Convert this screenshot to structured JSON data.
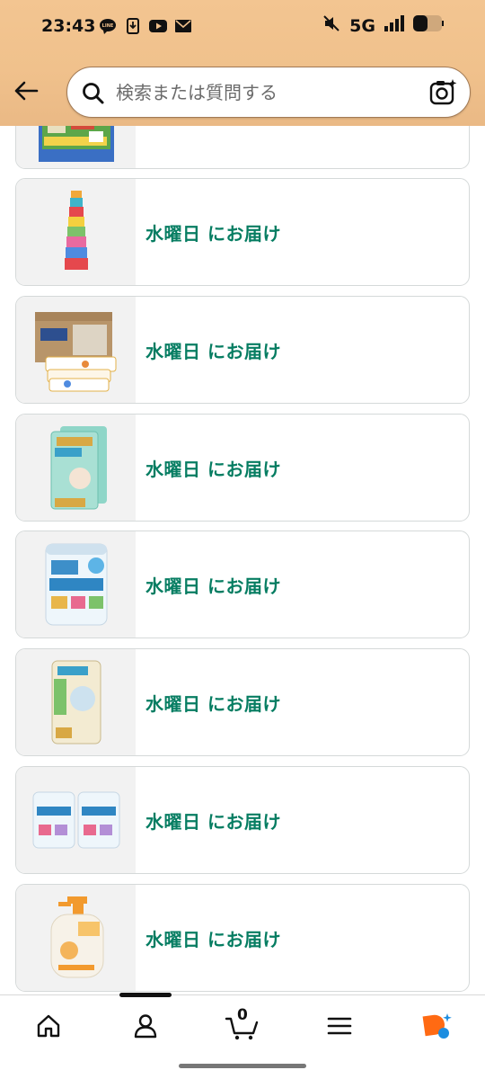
{
  "status_bar": {
    "time": "23:43",
    "network": "5G",
    "left_icons": [
      "line-icon",
      "download-icon",
      "youtube-icon",
      "mail-icon"
    ],
    "right_icons": [
      "mute-icon",
      "signal-icon",
      "battery-icon"
    ]
  },
  "search": {
    "placeholder": "検索または質問する"
  },
  "orders": [
    {
      "delivery": "",
      "image": "toy-playmat-box"
    },
    {
      "delivery": "水曜日 にお届け",
      "image": "stacking-cups-toy"
    },
    {
      "delivery": "水曜日 にお届け",
      "image": "goon-diapers-case"
    },
    {
      "delivery": "水曜日 にお届け",
      "image": "pampers-186-pack"
    },
    {
      "delivery": "水曜日 にお届け",
      "image": "hagukumi-formula-can"
    },
    {
      "delivery": "水曜日 にお届け",
      "image": "pampers-pants-48"
    },
    {
      "delivery": "水曜日 にお届け",
      "image": "hagukumi-formula-two-cans"
    },
    {
      "delivery": "水曜日 にお届け",
      "image": "pigeon-foam-soap-bottle"
    }
  ],
  "bottom_nav": {
    "items": [
      "home-icon",
      "account-icon",
      "cart-icon",
      "menu-icon",
      "rufus-icon"
    ],
    "cart_count": "0"
  },
  "colors": {
    "header_bg": "#f0c18c",
    "delivery_text": "#067d62",
    "card_border": "#d5d9d9",
    "rufus_orange": "#ff6a13",
    "rufus_blue": "#1c8de0"
  }
}
